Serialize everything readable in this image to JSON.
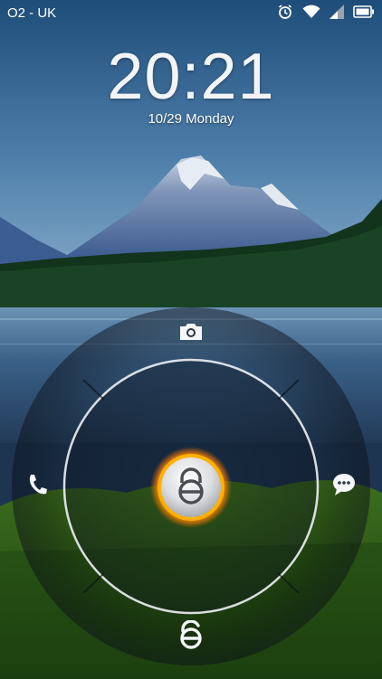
{
  "status_bar": {
    "carrier": "O2 - UK",
    "icons": [
      "alarm-icon",
      "wifi-icon",
      "signal-icon",
      "battery-icon"
    ]
  },
  "lockscreen": {
    "time": "20:21",
    "date": "10/29 Monday"
  },
  "unlock_ring": {
    "top_action": "camera-icon",
    "left_action": "phone-icon",
    "right_action": "message-icon",
    "bottom_action": "unlock-icon",
    "center": "lock-icon",
    "accent_color": "#ff8a00"
  }
}
